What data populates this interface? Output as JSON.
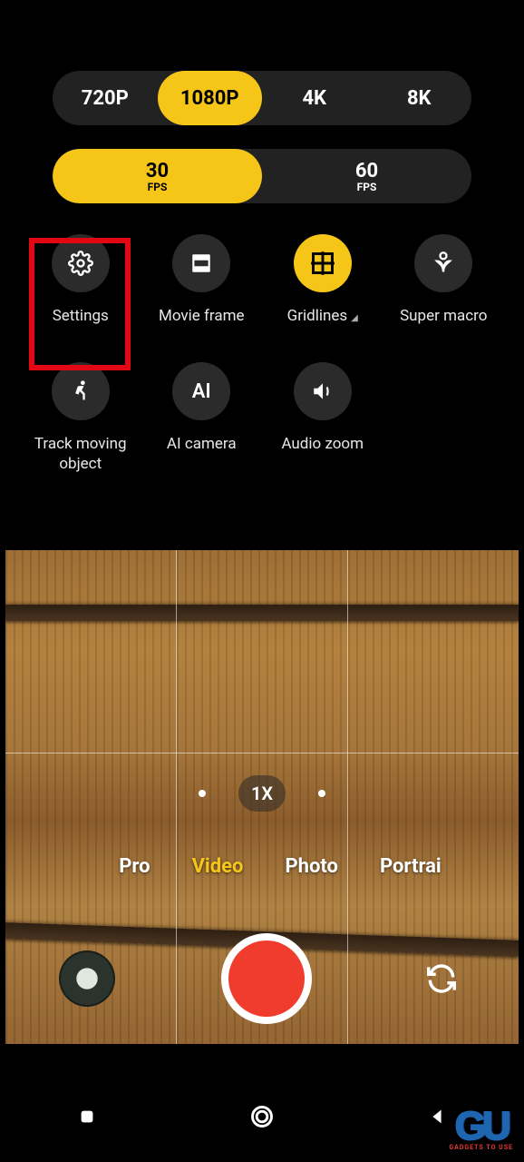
{
  "status": {
    "indicator_color": "#2ecc40"
  },
  "resolution_options": [
    "720P",
    "1080P",
    "4K",
    "8K"
  ],
  "resolution_selected": "1080P",
  "fps_options": [
    {
      "value": "30",
      "unit": "FPS"
    },
    {
      "value": "60",
      "unit": "FPS"
    }
  ],
  "fps_selected": "30",
  "settings": [
    {
      "id": "settings",
      "label": "Settings",
      "icon": "gear-icon",
      "active": false,
      "highlighted": true
    },
    {
      "id": "movie-frame",
      "label": "Movie frame",
      "icon": "movie-frame-icon",
      "active": false
    },
    {
      "id": "gridlines",
      "label": "Gridlines",
      "icon": "grid-icon",
      "active": true,
      "has_submenu": true
    },
    {
      "id": "super-macro",
      "label": "Super macro",
      "icon": "macro-icon",
      "active": false
    },
    {
      "id": "track",
      "label": "Track moving object",
      "icon": "track-icon",
      "active": false
    },
    {
      "id": "ai-camera",
      "label": "AI camera",
      "icon": "ai-icon",
      "active": false
    },
    {
      "id": "audio-zoom",
      "label": "Audio zoom",
      "icon": "audio-icon",
      "active": false
    }
  ],
  "zoom": {
    "current": "1X"
  },
  "modes": [
    "Pro",
    "Video",
    "Photo",
    "Portrai"
  ],
  "mode_selected": "Video",
  "watermark": {
    "logo_text": "GU",
    "subtitle": "GADGETS TO USE"
  },
  "accent_color": "#f5c518",
  "record_color": "#ef3c2d"
}
